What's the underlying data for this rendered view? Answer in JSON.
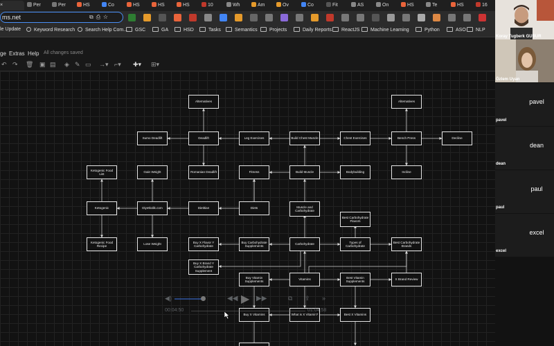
{
  "browser": {
    "tabs": [
      {
        "label": "×",
        "color": "#e8eaed"
      },
      {
        "label": "Per",
        "color": "#777"
      },
      {
        "label": "Per",
        "color": "#777"
      },
      {
        "label": "HS",
        "color": "#e9643b"
      },
      {
        "label": "Co",
        "color": "#4285f4"
      },
      {
        "label": "HS",
        "color": "#e9643b"
      },
      {
        "label": "HS",
        "color": "#e9643b"
      },
      {
        "label": "HS",
        "color": "#e9643b"
      },
      {
        "label": "10",
        "color": "#c0392b"
      },
      {
        "label": "Wh",
        "color": "#888"
      },
      {
        "label": "Am",
        "color": "#e59a2b"
      },
      {
        "label": "Ov",
        "color": "#e59a2b"
      },
      {
        "label": "Co",
        "color": "#4285f4"
      },
      {
        "label": "Fit",
        "color": "#555"
      },
      {
        "label": "AS",
        "color": "#888"
      },
      {
        "label": "On",
        "color": "#888"
      },
      {
        "label": "HS",
        "color": "#e9643b"
      },
      {
        "label": "Te",
        "color": "#888"
      },
      {
        "label": "HS",
        "color": "#e9643b"
      },
      {
        "label": "16",
        "color": "#c0392b"
      }
    ],
    "url": "ms.net",
    "bookmarks": [
      {
        "label": "le Update",
        "folder": false
      },
      {
        "label": "Keyword Research",
        "folder": false
      },
      {
        "label": "Search Help Com...",
        "folder": false
      },
      {
        "label": "GSC",
        "folder": true
      },
      {
        "label": "GA",
        "folder": true
      },
      {
        "label": "HSD",
        "folder": true
      },
      {
        "label": "Tasks",
        "folder": true
      },
      {
        "label": "Semantics",
        "folder": true
      },
      {
        "label": "Projects",
        "folder": true
      },
      {
        "label": "Daily Reports",
        "folder": true
      },
      {
        "label": "ReactJS",
        "folder": true
      },
      {
        "label": "Machine Learning",
        "folder": true
      },
      {
        "label": "Python",
        "folder": true
      },
      {
        "label": "ASO",
        "folder": true
      },
      {
        "label": "NLP",
        "folder": true
      }
    ]
  },
  "app": {
    "menu": [
      "ge",
      "Extras",
      "Help"
    ],
    "save_status": "All changes saved"
  },
  "diagram": {
    "nodes": [
      {
        "id": "alt1",
        "label": "Alternatives"
      },
      {
        "id": "alt2",
        "label": "Alternatives"
      },
      {
        "id": "sumo",
        "label": "Sumo Deadlift"
      },
      {
        "id": "deadlift",
        "label": "Deadlift"
      },
      {
        "id": "leg",
        "label": "Leg Exercises"
      },
      {
        "id": "chest_build",
        "label": "Build Chest Muscle"
      },
      {
        "id": "chest_ex",
        "label": "Chest Exercises"
      },
      {
        "id": "bench",
        "label": "Bench Press"
      },
      {
        "id": "decline",
        "label": "Decline"
      },
      {
        "id": "keto_list",
        "label": "Ketogenic Food List"
      },
      {
        "id": "gain",
        "label": "Gain Weight"
      },
      {
        "id": "romanian",
        "label": "Romanian Deadlift"
      },
      {
        "id": "fitness",
        "label": "Fitness"
      },
      {
        "id": "build_muscle",
        "label": "Build Muscle"
      },
      {
        "id": "bodybuilding",
        "label": "Bodybuilding"
      },
      {
        "id": "incline",
        "label": "Incline"
      },
      {
        "id": "keto",
        "label": "Ketogenic"
      },
      {
        "id": "diyetkolik",
        "label": "Diyetkolik.com"
      },
      {
        "id": "dietitian",
        "label": "Dietitian"
      },
      {
        "id": "diets",
        "label": "Diets"
      },
      {
        "id": "muscle_carb",
        "label": "Muscle and Carbohydrate"
      },
      {
        "id": "best_carb_flavor",
        "label": "Best Carbohydrate Flavors"
      },
      {
        "id": "keto_recipe",
        "label": "Ketogenic Food Recipe"
      },
      {
        "id": "lose",
        "label": "Lose Weight"
      },
      {
        "id": "buy_flavor",
        "label": "Buy X Flavor Y Carbohydrate"
      },
      {
        "id": "buy_carb",
        "label": "Buy Carbohydrate Supplements"
      },
      {
        "id": "carb",
        "label": "Carbohydrate"
      },
      {
        "id": "types_carb",
        "label": "Types of Carbohydrate"
      },
      {
        "id": "best_carb_brands",
        "label": "Best Carbohydrate Brands"
      },
      {
        "id": "buy_brand",
        "label": "Buy X Brand Y Carbohydrate Supplement"
      },
      {
        "id": "buy_vit",
        "label": "Buy Vitamin Supplements"
      },
      {
        "id": "vitamins",
        "label": "Vitamins"
      },
      {
        "id": "best_vit",
        "label": "Best Vitamin Supplements"
      },
      {
        "id": "brand_review",
        "label": "X Brand Review"
      },
      {
        "id": "buy_x_vit",
        "label": "Buy X Vitamins"
      },
      {
        "id": "what_vit",
        "label": "What is X Vitamin?"
      },
      {
        "id": "best_x_vit",
        "label": "Best X Vitamins"
      }
    ]
  },
  "video_overlay": {
    "time_left": "00:04:50",
    "time_right": "01:04:58"
  },
  "meeting": {
    "participants": [
      {
        "name": "Koray Tugberk GUBUR",
        "avatar": "",
        "type": "video"
      },
      {
        "name": "Özlem Uyan",
        "avatar": "",
        "type": "video"
      },
      {
        "name": "pavel",
        "avatar": "pavel",
        "type": "name"
      },
      {
        "name": "dean",
        "avatar": "dean",
        "type": "name"
      },
      {
        "name": "paul",
        "avatar": "paul",
        "type": "name"
      },
      {
        "name": "excel",
        "avatar": "excel",
        "type": "name"
      }
    ]
  }
}
